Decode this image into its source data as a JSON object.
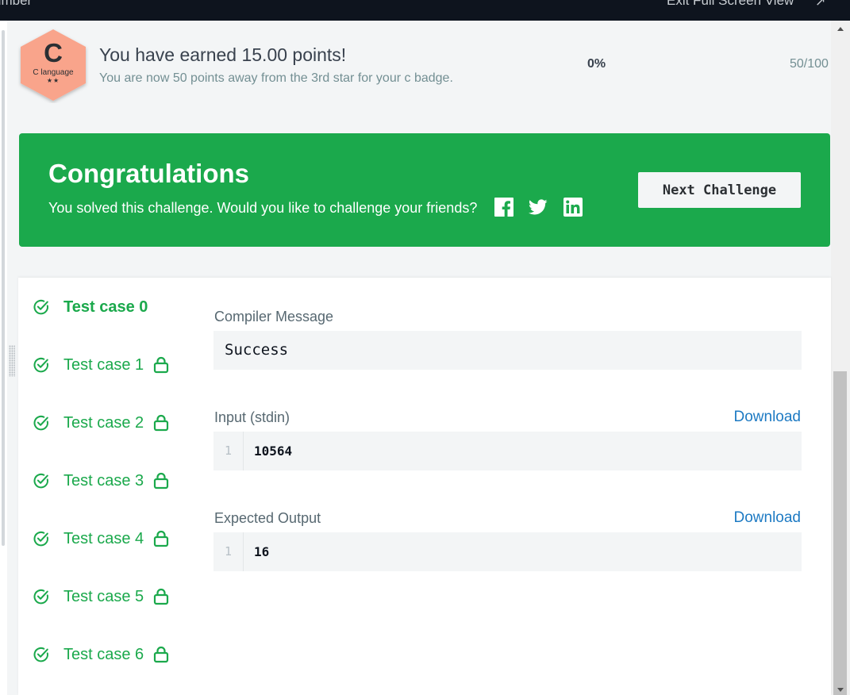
{
  "topbar": {
    "crumb": "umber",
    "exit_label": "Exit Full Screen View",
    "exit_icon": "collapse-icon"
  },
  "badge": {
    "letter": "C",
    "language": "C language",
    "stars": "★★",
    "color": "#f9a48b"
  },
  "points": {
    "earned": "You have earned 15.00 points!",
    "away": "You are now 50 points away from the 3rd star for your c badge.",
    "percent": "0%",
    "value": "50/100"
  },
  "congrats": {
    "title": "Congratulations",
    "subtitle": "You solved this challenge. Would you like to challenge your friends?",
    "next_label": "Next Challenge",
    "social_icons": [
      "facebook-icon",
      "twitter-icon",
      "linkedin-icon"
    ],
    "bg_color": "#1ba94c"
  },
  "test_cases": [
    {
      "label": "Test case 0",
      "locked": false,
      "active": true
    },
    {
      "label": "Test case 1",
      "locked": true,
      "active": false
    },
    {
      "label": "Test case 2",
      "locked": true,
      "active": false
    },
    {
      "label": "Test case 3",
      "locked": true,
      "active": false
    },
    {
      "label": "Test case 4",
      "locked": true,
      "active": false
    },
    {
      "label": "Test case 5",
      "locked": true,
      "active": false
    },
    {
      "label": "Test case 6",
      "locked": true,
      "active": false
    }
  ],
  "details": {
    "compiler_label": "Compiler Message",
    "compiler_message": "Success",
    "input_label": "Input (stdin)",
    "input_line_no": "1",
    "input_value": "10564",
    "expected_label": "Expected Output",
    "expected_line_no": "1",
    "expected_value": "16",
    "download_label": "Download"
  },
  "colors": {
    "green": "#1ba94c",
    "link": "#1d7ac3",
    "dark": "#0e141e"
  }
}
